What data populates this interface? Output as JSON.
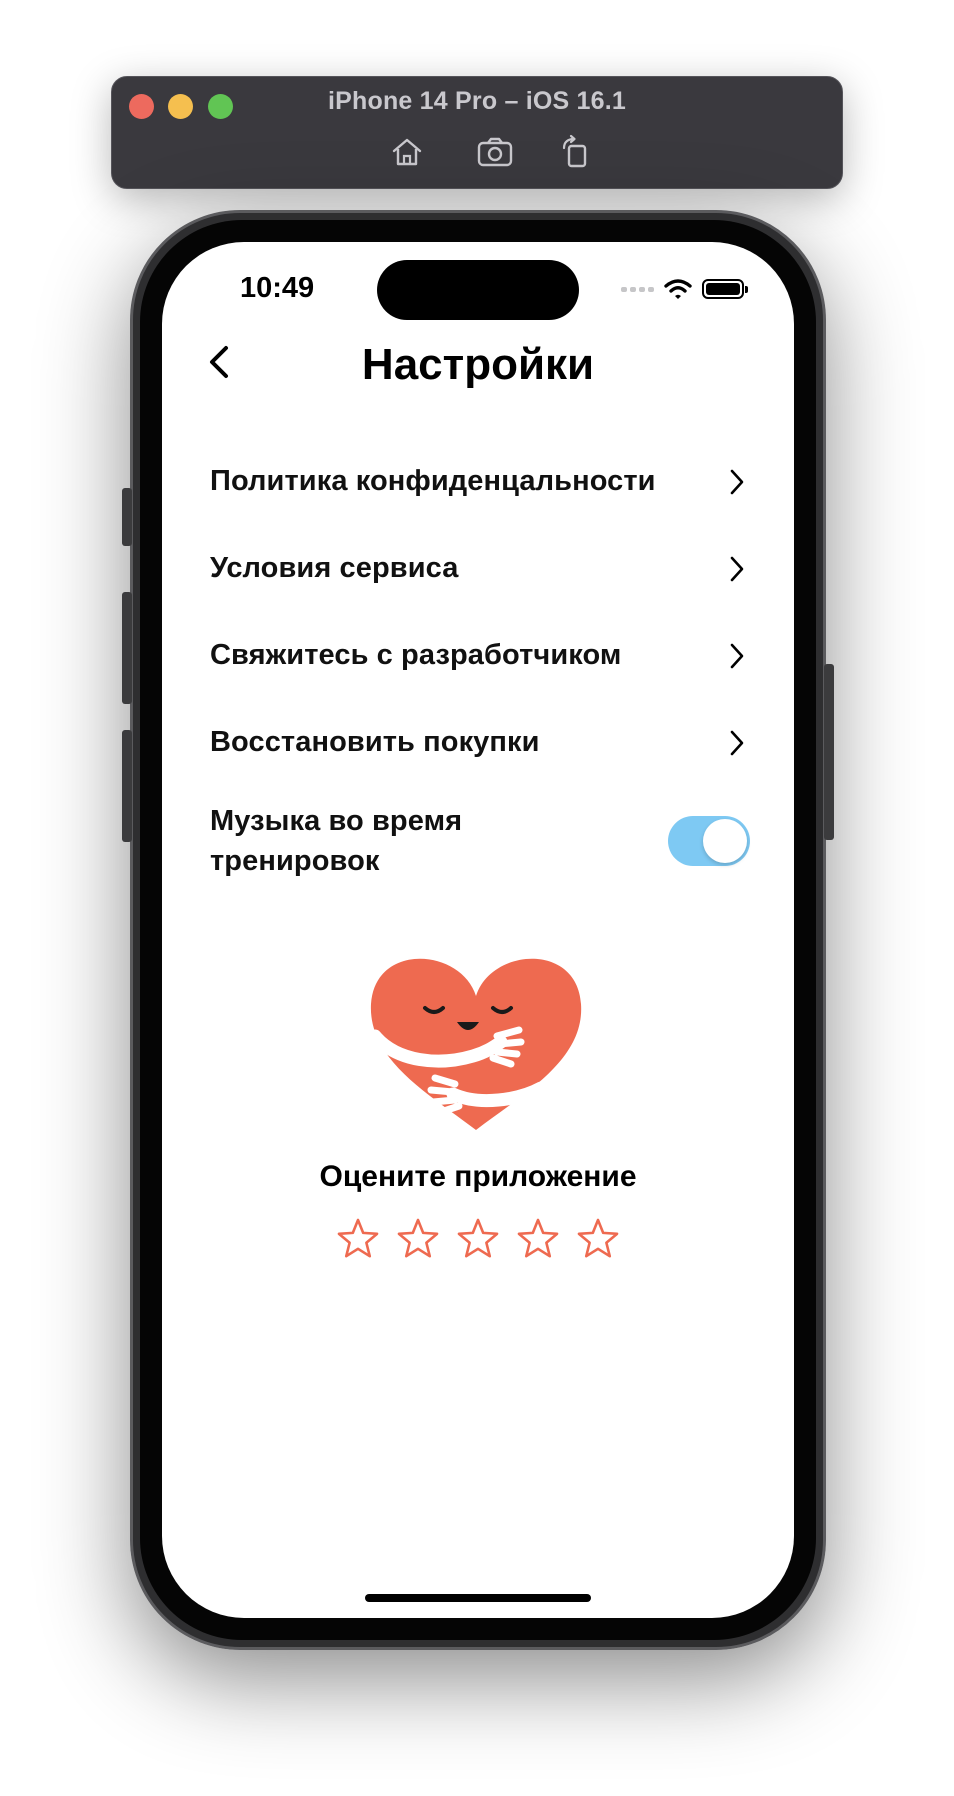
{
  "simulator": {
    "title": "iPhone 14 Pro – iOS 16.1",
    "buttons": [
      "home-icon",
      "screenshot-icon",
      "rotate-icon"
    ]
  },
  "status_bar": {
    "time": "10:49"
  },
  "header": {
    "title": "Настройки"
  },
  "settings": {
    "items": [
      {
        "label": "Политика конфиденцальности"
      },
      {
        "label": "Условия сервиса"
      },
      {
        "label": "Свяжитесь с разработчиком"
      },
      {
        "label": "Восстановить покупки"
      }
    ],
    "music_toggle": {
      "label": "Музыка во время тренировок",
      "on": true
    }
  },
  "rate": {
    "label": "Оцените приложение",
    "stars_total": 5,
    "stars_selected": 0
  },
  "colors": {
    "accent": "#ee6a50",
    "toggle_on": "#7ec9f3",
    "title_bar": "#3a393e"
  }
}
